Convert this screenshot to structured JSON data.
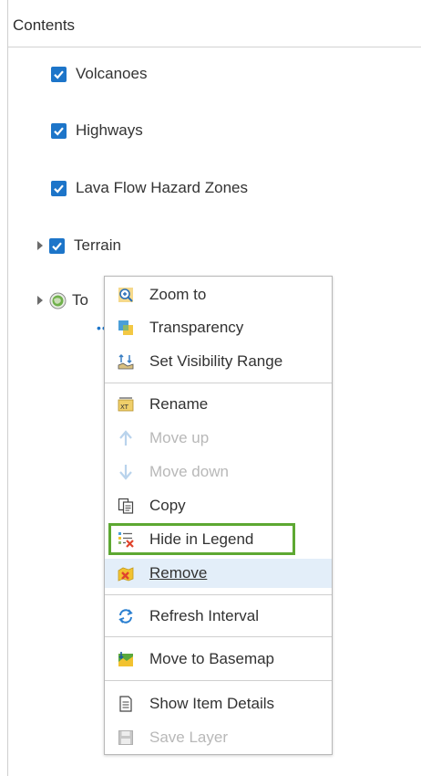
{
  "header": {
    "title": "Contents"
  },
  "layers": [
    {
      "label": "Volcanoes",
      "checked": true
    },
    {
      "label": "Highways",
      "checked": true
    },
    {
      "label": "Lava Flow Hazard Zones",
      "checked": true
    },
    {
      "label": "Terrain",
      "checked": true,
      "expandable": true
    },
    {
      "label": "To",
      "expandable": true,
      "icon": "globe-icon"
    }
  ],
  "more_options": {
    "icon": "ellipsis-icon"
  },
  "context_menu": {
    "items": [
      {
        "label": "Zoom to",
        "icon": "zoom-to-icon",
        "enabled": true
      },
      {
        "label": "Transparency",
        "icon": "transparency-icon",
        "enabled": true
      },
      {
        "label": "Set Visibility Range",
        "icon": "visibility-range-icon",
        "enabled": true
      },
      {
        "label": "Rename",
        "icon": "rename-icon",
        "enabled": true
      },
      {
        "label": "Move up",
        "icon": "arrow-up-icon",
        "enabled": false
      },
      {
        "label": "Move down",
        "icon": "arrow-down-icon",
        "enabled": false
      },
      {
        "label": "Copy",
        "icon": "copy-icon",
        "enabled": true
      },
      {
        "label": "Hide in Legend",
        "icon": "hide-in-legend-icon",
        "enabled": true,
        "highlighted": true
      },
      {
        "label": "Remove",
        "icon": "remove-icon",
        "enabled": true,
        "hovered": true
      },
      {
        "label": "Refresh Interval",
        "icon": "refresh-icon",
        "enabled": true
      },
      {
        "label": "Move to Basemap",
        "icon": "move-to-basemap-icon",
        "enabled": true
      },
      {
        "label": "Show Item Details",
        "icon": "item-details-icon",
        "enabled": true
      },
      {
        "label": "Save Layer",
        "icon": "save-icon",
        "enabled": false
      }
    ]
  },
  "colors": {
    "accent": "#1d75c9",
    "highlight_border": "#5da832",
    "hover_background": "#e3eef9",
    "disabled_text": "#b8b8b8"
  }
}
